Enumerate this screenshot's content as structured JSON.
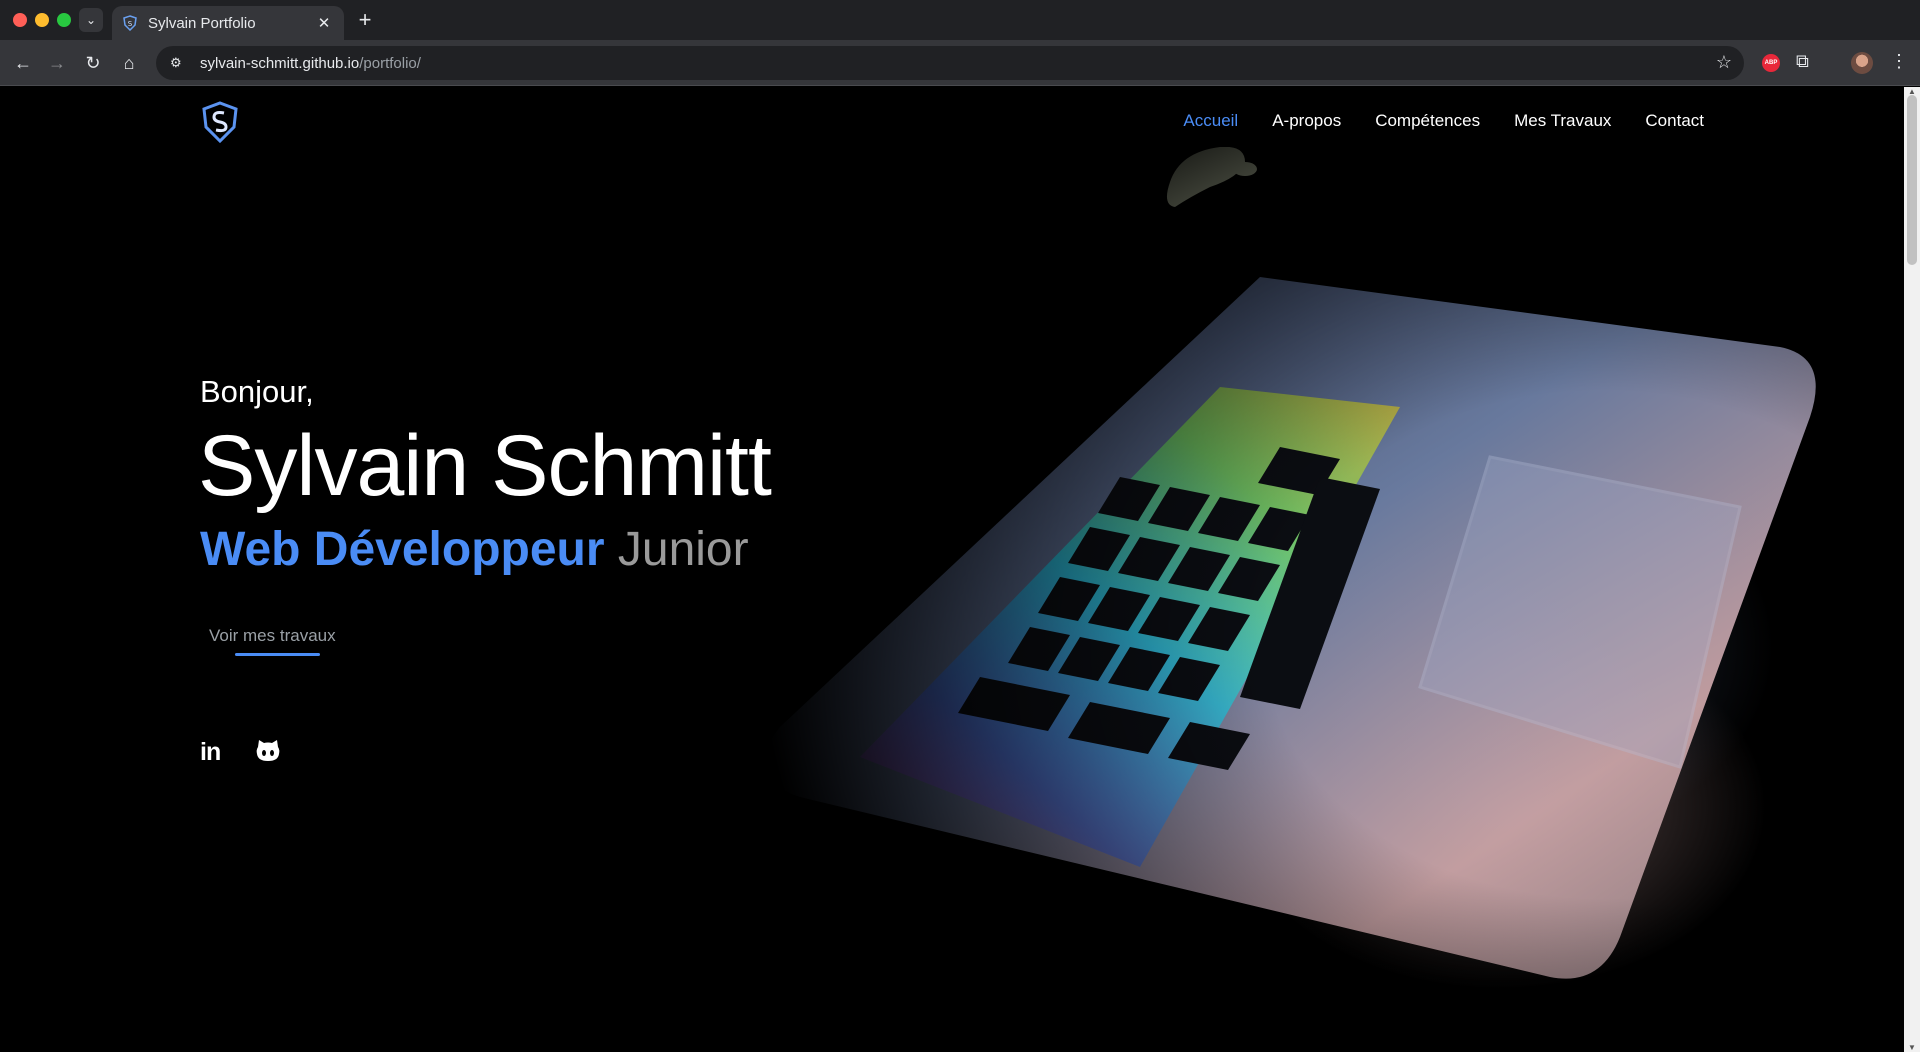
{
  "browser": {
    "tab_title": "Sylvain Portfolio",
    "tab_close": "✕",
    "new_tab": "+",
    "url_host": "sylvain-schmitt.github.io",
    "url_path": "/portfolio/",
    "abp_label": "ABP"
  },
  "nav": {
    "items": [
      {
        "label": "Accueil",
        "active": true
      },
      {
        "label": "A-propos",
        "active": false
      },
      {
        "label": "Compétences",
        "active": false
      },
      {
        "label": "Mes Travaux",
        "active": false
      },
      {
        "label": "Contact",
        "active": false
      }
    ]
  },
  "hero": {
    "greeting": "Bonjour,",
    "name": "Sylvain Schmitt",
    "role_main": "Web Développeur",
    "role_sub": "Junior",
    "cta": "Voir mes travaux",
    "linkedin_label": "in"
  },
  "colors": {
    "accent": "#4a8cf5",
    "background": "#000000",
    "text": "#ffffff",
    "muted": "#9a9a9a"
  },
  "icons": [
    "logo-icon",
    "linkedin-icon",
    "github-icon",
    "back-icon",
    "forward-icon",
    "reload-icon",
    "home-icon",
    "site-info-icon",
    "star-icon",
    "extensions-icon",
    "menu-icon"
  ]
}
